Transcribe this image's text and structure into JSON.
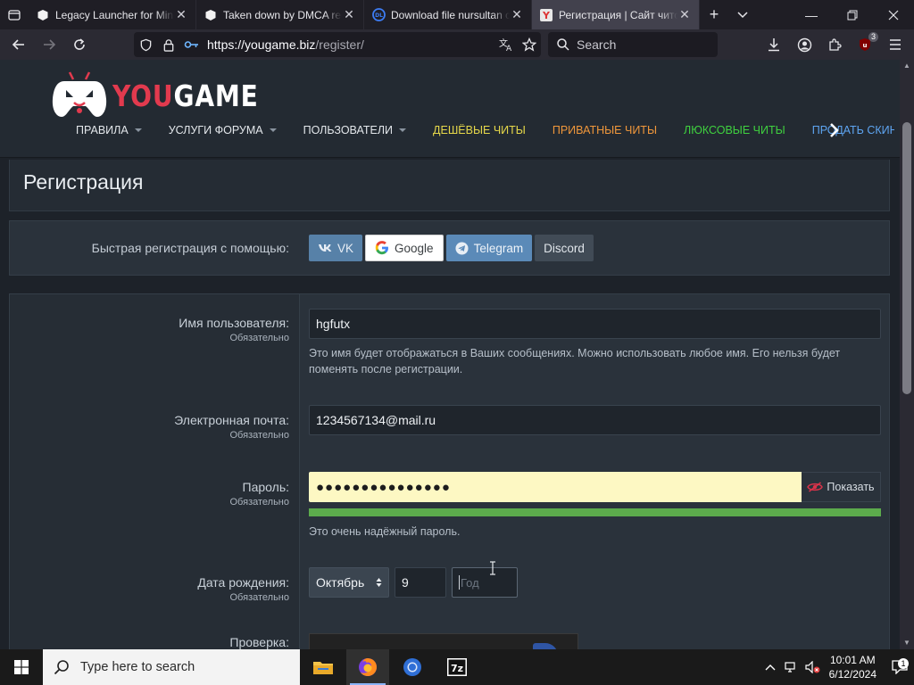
{
  "browser": {
    "tabs": [
      {
        "title": "Legacy Launcher for Minecraft",
        "active": false
      },
      {
        "title": "Taken down by DMCA request",
        "active": false
      },
      {
        "title": "Download file nursultan client",
        "active": false
      },
      {
        "title": "Регистрация | Сайт читов",
        "active": true
      }
    ],
    "url_main": "https://yougame.biz",
    "url_path": "/register/",
    "search_placeholder": "Search",
    "extension_badge": "3"
  },
  "site": {
    "logo_you": "YOU",
    "logo_game": "GAME",
    "nav": [
      {
        "label": "ПРАВИЛА",
        "dropdown": true,
        "color": "#e3e7eb"
      },
      {
        "label": "УСЛУГИ ФОРУМА",
        "dropdown": true,
        "color": "#e3e7eb"
      },
      {
        "label": "ПОЛЬЗОВАТЕЛИ",
        "dropdown": true,
        "color": "#e3e7eb"
      },
      {
        "label": "ДЕШЁВЫЕ ЧИТЫ",
        "dropdown": false,
        "color": "#e6d84a"
      },
      {
        "label": "ПРИВАТНЫЕ ЧИТЫ",
        "dropdown": false,
        "color": "#f0973b"
      },
      {
        "label": "ЛЮКСОВЫЕ ЧИТЫ",
        "dropdown": false,
        "color": "#3fd13f"
      },
      {
        "label": "ПРОДАТЬ СКИН",
        "dropdown": false,
        "color": "#5ea5f2"
      }
    ]
  },
  "page": {
    "title": "Регистрация",
    "quick_label": "Быстрая регистрация с помощью:",
    "quick_buttons": {
      "vk": "VK",
      "google": "Google",
      "telegram": "Telegram",
      "discord": "Discord"
    },
    "required": "Обязательно",
    "username": {
      "label": "Имя пользователя:",
      "value": "hgfutx",
      "hint": "Это имя будет отображаться в Ваших сообщениях. Можно использовать любое имя. Его нельзя будет поменять после регистрации."
    },
    "email": {
      "label": "Электронная почта:",
      "value": "1234567134@mail.ru"
    },
    "password": {
      "label": "Пароль:",
      "value": "●●●●●●●●●●●●●●●",
      "show_label": "Показать",
      "strength_text": "Это очень надёжный пароль.",
      "strength_fraction": 1.0
    },
    "dob": {
      "label": "Дата рождения:",
      "month": "Октябрь",
      "day": "9",
      "year_placeholder": "Год"
    },
    "captcha": {
      "label": "Проверка:"
    }
  },
  "taskbar": {
    "search_placeholder": "Type here to search",
    "time": "10:01 AM",
    "date": "6/12/2024",
    "notification_count": "1"
  }
}
